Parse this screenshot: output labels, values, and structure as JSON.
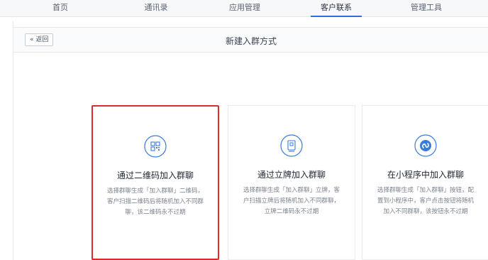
{
  "nav": {
    "items": [
      {
        "label": "首页"
      },
      {
        "label": "通讯录"
      },
      {
        "label": "应用管理"
      },
      {
        "label": "客户联系"
      },
      {
        "label": "管理工具"
      }
    ],
    "active_index": 3
  },
  "header": {
    "back_label": "« 返回",
    "title": "新建入群方式"
  },
  "cards": [
    {
      "icon": "qrcode-icon",
      "title": "通过二维码加入群聊",
      "desc": "选择群聊生成「加入群聊」二维码，客户扫描二维码后将随机加入不同群聊，该二维码永不过期",
      "highlighted": true
    },
    {
      "icon": "standee-icon",
      "title": "通过立牌加入群聊",
      "desc": "选择群聊生成「加入群聊」立牌，客户扫描立牌后将随机加入不同群聊，立牌二维码永不过期",
      "highlighted": false
    },
    {
      "icon": "miniprogram-icon",
      "title": "在小程序中加入群聊",
      "desc": "选择群聊生成「加入群聊」按钮，配置到小程序中，客户点击按钮将随机加入不同群聊，该按钮永不过期",
      "highlighted": false
    }
  ],
  "colors": {
    "accent": "#2f6fd6",
    "highlight_border": "#e02a2a",
    "icon": "#3a7bd5"
  }
}
